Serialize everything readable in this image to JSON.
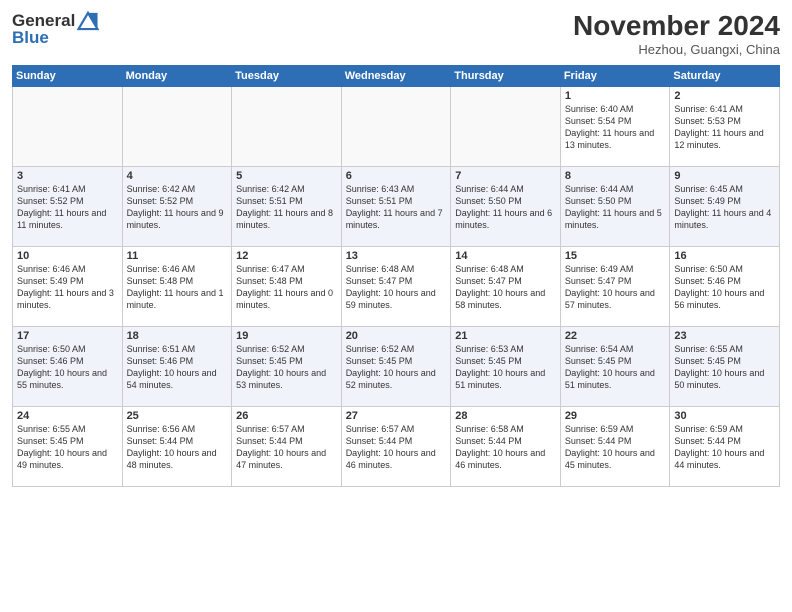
{
  "header": {
    "logo_line1": "General",
    "logo_line2": "Blue",
    "month": "November 2024",
    "location": "Hezhou, Guangxi, China"
  },
  "days_of_week": [
    "Sunday",
    "Monday",
    "Tuesday",
    "Wednesday",
    "Thursday",
    "Friday",
    "Saturday"
  ],
  "weeks": [
    [
      {
        "day": "",
        "info": ""
      },
      {
        "day": "",
        "info": ""
      },
      {
        "day": "",
        "info": ""
      },
      {
        "day": "",
        "info": ""
      },
      {
        "day": "",
        "info": ""
      },
      {
        "day": "1",
        "info": "Sunrise: 6:40 AM\nSunset: 5:54 PM\nDaylight: 11 hours and 13 minutes."
      },
      {
        "day": "2",
        "info": "Sunrise: 6:41 AM\nSunset: 5:53 PM\nDaylight: 11 hours and 12 minutes."
      }
    ],
    [
      {
        "day": "3",
        "info": "Sunrise: 6:41 AM\nSunset: 5:52 PM\nDaylight: 11 hours and 11 minutes."
      },
      {
        "day": "4",
        "info": "Sunrise: 6:42 AM\nSunset: 5:52 PM\nDaylight: 11 hours and 9 minutes."
      },
      {
        "day": "5",
        "info": "Sunrise: 6:42 AM\nSunset: 5:51 PM\nDaylight: 11 hours and 8 minutes."
      },
      {
        "day": "6",
        "info": "Sunrise: 6:43 AM\nSunset: 5:51 PM\nDaylight: 11 hours and 7 minutes."
      },
      {
        "day": "7",
        "info": "Sunrise: 6:44 AM\nSunset: 5:50 PM\nDaylight: 11 hours and 6 minutes."
      },
      {
        "day": "8",
        "info": "Sunrise: 6:44 AM\nSunset: 5:50 PM\nDaylight: 11 hours and 5 minutes."
      },
      {
        "day": "9",
        "info": "Sunrise: 6:45 AM\nSunset: 5:49 PM\nDaylight: 11 hours and 4 minutes."
      }
    ],
    [
      {
        "day": "10",
        "info": "Sunrise: 6:46 AM\nSunset: 5:49 PM\nDaylight: 11 hours and 3 minutes."
      },
      {
        "day": "11",
        "info": "Sunrise: 6:46 AM\nSunset: 5:48 PM\nDaylight: 11 hours and 1 minute."
      },
      {
        "day": "12",
        "info": "Sunrise: 6:47 AM\nSunset: 5:48 PM\nDaylight: 11 hours and 0 minutes."
      },
      {
        "day": "13",
        "info": "Sunrise: 6:48 AM\nSunset: 5:47 PM\nDaylight: 10 hours and 59 minutes."
      },
      {
        "day": "14",
        "info": "Sunrise: 6:48 AM\nSunset: 5:47 PM\nDaylight: 10 hours and 58 minutes."
      },
      {
        "day": "15",
        "info": "Sunrise: 6:49 AM\nSunset: 5:47 PM\nDaylight: 10 hours and 57 minutes."
      },
      {
        "day": "16",
        "info": "Sunrise: 6:50 AM\nSunset: 5:46 PM\nDaylight: 10 hours and 56 minutes."
      }
    ],
    [
      {
        "day": "17",
        "info": "Sunrise: 6:50 AM\nSunset: 5:46 PM\nDaylight: 10 hours and 55 minutes."
      },
      {
        "day": "18",
        "info": "Sunrise: 6:51 AM\nSunset: 5:46 PM\nDaylight: 10 hours and 54 minutes."
      },
      {
        "day": "19",
        "info": "Sunrise: 6:52 AM\nSunset: 5:45 PM\nDaylight: 10 hours and 53 minutes."
      },
      {
        "day": "20",
        "info": "Sunrise: 6:52 AM\nSunset: 5:45 PM\nDaylight: 10 hours and 52 minutes."
      },
      {
        "day": "21",
        "info": "Sunrise: 6:53 AM\nSunset: 5:45 PM\nDaylight: 10 hours and 51 minutes."
      },
      {
        "day": "22",
        "info": "Sunrise: 6:54 AM\nSunset: 5:45 PM\nDaylight: 10 hours and 51 minutes."
      },
      {
        "day": "23",
        "info": "Sunrise: 6:55 AM\nSunset: 5:45 PM\nDaylight: 10 hours and 50 minutes."
      }
    ],
    [
      {
        "day": "24",
        "info": "Sunrise: 6:55 AM\nSunset: 5:45 PM\nDaylight: 10 hours and 49 minutes."
      },
      {
        "day": "25",
        "info": "Sunrise: 6:56 AM\nSunset: 5:44 PM\nDaylight: 10 hours and 48 minutes."
      },
      {
        "day": "26",
        "info": "Sunrise: 6:57 AM\nSunset: 5:44 PM\nDaylight: 10 hours and 47 minutes."
      },
      {
        "day": "27",
        "info": "Sunrise: 6:57 AM\nSunset: 5:44 PM\nDaylight: 10 hours and 46 minutes."
      },
      {
        "day": "28",
        "info": "Sunrise: 6:58 AM\nSunset: 5:44 PM\nDaylight: 10 hours and 46 minutes."
      },
      {
        "day": "29",
        "info": "Sunrise: 6:59 AM\nSunset: 5:44 PM\nDaylight: 10 hours and 45 minutes."
      },
      {
        "day": "30",
        "info": "Sunrise: 6:59 AM\nSunset: 5:44 PM\nDaylight: 10 hours and 44 minutes."
      }
    ]
  ]
}
